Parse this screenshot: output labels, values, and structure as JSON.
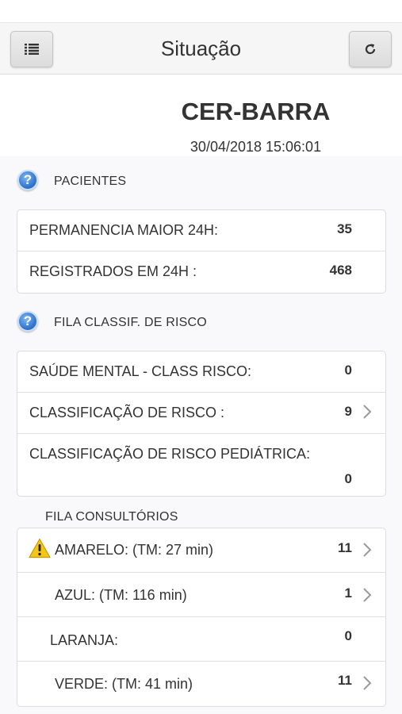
{
  "navbar": {
    "title": "Situação",
    "menu_icon": "list-icon",
    "refresh_icon": "refresh-icon"
  },
  "header": {
    "unit_name": "CER-BARRA",
    "timestamp": "30/04/2018 15:06:01"
  },
  "pacientes": {
    "title": "PACIENTES",
    "rows": [
      {
        "label": "PERMANENCIA MAIOR 24H:",
        "value": "35"
      },
      {
        "label": "REGISTRADOS EM 24H :",
        "value": "468"
      }
    ]
  },
  "fila_risco": {
    "title": "FILA CLASSIF. DE RISCO",
    "rows": [
      {
        "label": "SAÚDE MENTAL - CLASS RISCO:",
        "value": "0"
      },
      {
        "label": "CLASSIFICAÇÃO DE RISCO :",
        "value": "9",
        "has_chevron": true
      },
      {
        "label": "CLASSIFICAÇÃO DE RISCO PEDIÁTRICA:",
        "value": "0"
      }
    ]
  },
  "fila_consultorios": {
    "title": "FILA CONSULTÓRIOS",
    "rows": [
      {
        "label": "AMARELO: (TM: 27 min)",
        "value": "11",
        "has_chevron": true,
        "warning_icon": "warning-icon"
      },
      {
        "label": "AZUL: (TM: 116 min)",
        "value": "1",
        "has_chevron": true
      },
      {
        "label": "LARANJA:",
        "value": "0"
      },
      {
        "label": "VERDE: (TM: 41 min)",
        "value": "11",
        "has_chevron": true
      }
    ]
  },
  "colors": {
    "nav_bg": "#f6f6f6",
    "content_bg": "#f9f9fb",
    "help_icon_blue": "#2a6fc9",
    "warning_yellow": "#f5c518"
  }
}
